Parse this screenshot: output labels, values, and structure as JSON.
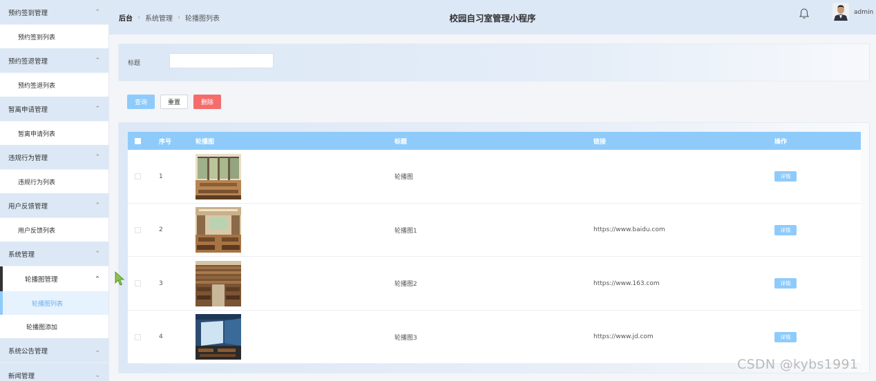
{
  "sidebar": {
    "groups": [
      {
        "title": "预约签到管理",
        "items": [
          "预约签到列表"
        ]
      },
      {
        "title": "预约签退管理",
        "items": [
          "预约签退列表"
        ]
      },
      {
        "title": "暂离申请管理",
        "items": [
          "暂离申请列表"
        ]
      },
      {
        "title": "违规行为管理",
        "items": [
          "违规行为列表"
        ]
      },
      {
        "title": "用户反馈管理",
        "items": [
          "用户反馈列表"
        ]
      },
      {
        "title": "系统管理",
        "sub": {
          "title": "轮播图管理",
          "items": [
            "轮播图列表",
            "轮播图添加"
          ]
        }
      },
      {
        "title": "系统公告管理"
      },
      {
        "title": "新闻管理"
      }
    ]
  },
  "header": {
    "breadcrumb": [
      "后台",
      "系统管理",
      "轮播图列表"
    ],
    "app_title": "校园自习室管理小程序",
    "username": "admin"
  },
  "search": {
    "label": "标题",
    "value": "",
    "placeholder": ""
  },
  "buttons": {
    "query": "查询",
    "reset": "重置",
    "delete": "删除"
  },
  "table": {
    "columns": [
      "序号",
      "轮播图",
      "标题",
      "链接",
      "操作"
    ],
    "rows": [
      {
        "index": "1",
        "title": "轮播图",
        "link": "",
        "action": "详情"
      },
      {
        "index": "2",
        "title": "轮播图1",
        "link": "https://www.baidu.com",
        "action": "详情"
      },
      {
        "index": "3",
        "title": "轮播图2",
        "link": "https://www.163.com",
        "action": "详情"
      },
      {
        "index": "4",
        "title": "轮播图3",
        "link": "https://www.jd.com",
        "action": "详情"
      }
    ]
  },
  "watermark": "CSDN @kybs1991",
  "colors": {
    "accent": "#8ecbfb",
    "danger": "#f46c6c",
    "panel": "#dce8f6"
  }
}
